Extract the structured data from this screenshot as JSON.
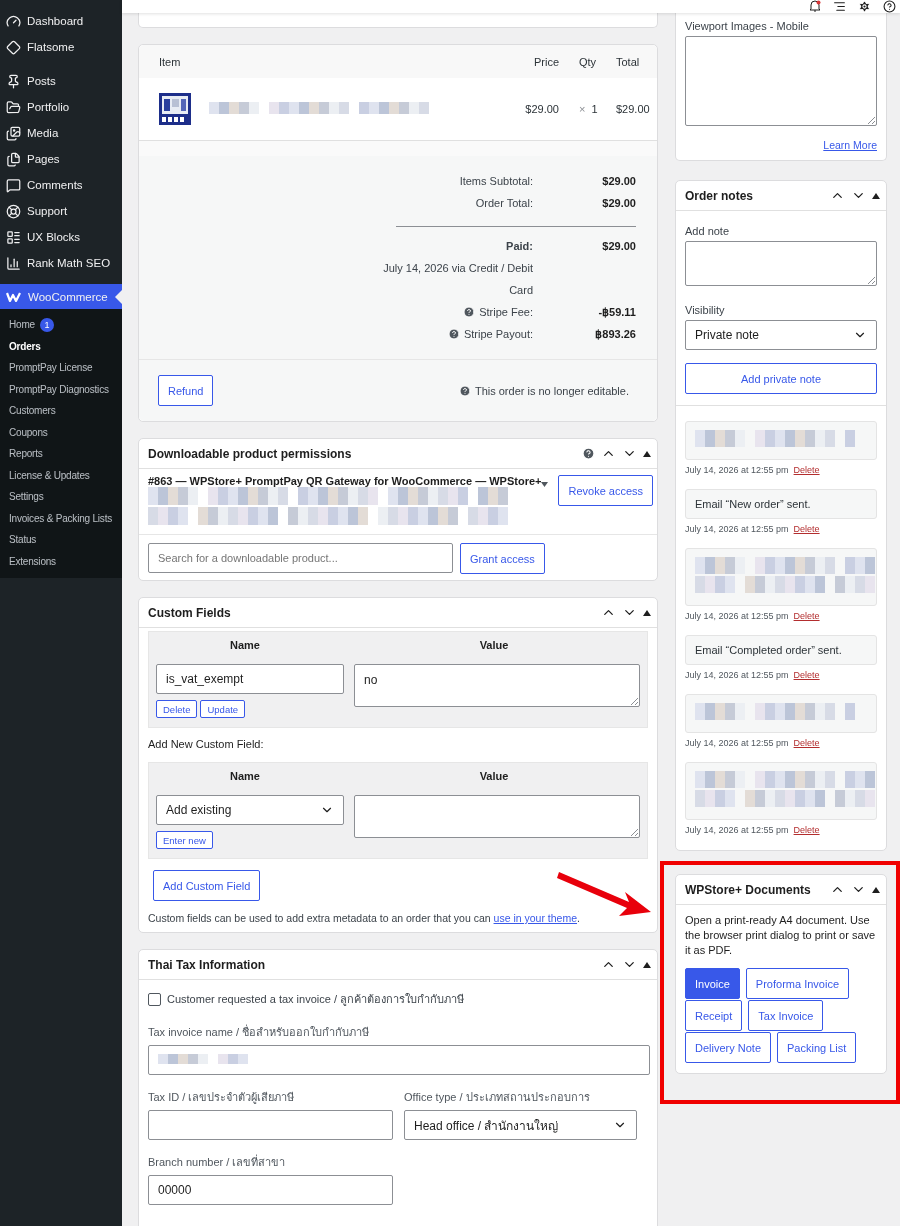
{
  "sidebar": {
    "items": [
      {
        "label": "Dashboard",
        "selected": false
      },
      {
        "label": "Flatsome",
        "selected": false
      },
      {
        "label": "Posts",
        "selected": false
      },
      {
        "label": "Portfolio",
        "selected": false
      },
      {
        "label": "Media",
        "selected": false
      },
      {
        "label": "Pages",
        "selected": false
      },
      {
        "label": "Comments",
        "selected": false
      },
      {
        "label": "Support",
        "selected": false
      },
      {
        "label": "UX Blocks",
        "selected": false
      },
      {
        "label": "Rank Math SEO",
        "selected": false
      },
      {
        "label": "WooCommerce",
        "selected": true
      }
    ],
    "submenu": [
      {
        "label": "Home",
        "badge": "1",
        "selected": false
      },
      {
        "label": "Orders",
        "selected": true
      },
      {
        "label": "PromptPay License",
        "selected": false
      },
      {
        "label": "PromptPay Diagnostics",
        "selected": false
      },
      {
        "label": "Customers",
        "selected": false
      },
      {
        "label": "Coupons",
        "selected": false
      },
      {
        "label": "Reports",
        "selected": false
      },
      {
        "label": "License & Updates",
        "selected": false
      },
      {
        "label": "Settings",
        "selected": false
      },
      {
        "label": "Invoices & Packing Lists",
        "selected": false
      },
      {
        "label": "Status",
        "selected": false
      },
      {
        "label": "Extensions",
        "selected": false
      }
    ]
  },
  "order_items": {
    "columns": [
      "Item",
      "Price",
      "Qty",
      "Total"
    ],
    "rows": [
      {
        "price": "$29.00",
        "qty_mark": "×",
        "qty": "1",
        "total": "$29.00"
      }
    ],
    "totals": [
      {
        "kind": "plain",
        "label": "Items Subtotal:",
        "value": "$29.00"
      },
      {
        "kind": "plain",
        "label": "Order Total:",
        "value": "$29.00"
      },
      {
        "kind": "paid",
        "label": "Paid:",
        "value": "$29.00"
      },
      {
        "kind": "note",
        "label": "July 14, 2026 via Credit / Debit Card"
      },
      {
        "kind": "fee",
        "label": "Stripe Fee:",
        "value": "-฿59.11"
      },
      {
        "kind": "fee",
        "label": "Stripe Payout:",
        "value": "฿893.26"
      }
    ],
    "refund_button": "Refund",
    "locked_note": "This order is no longer editable."
  },
  "downloads": {
    "title": "Downloadable product permissions",
    "product": "#863 — WPStore+ PromptPay QR Gateway for WooCommerce — WPStore+",
    "revoke_button": "Revoke access",
    "search": {
      "placeholder": "Search for a downloadable product..."
    },
    "grant_button": "Grant access"
  },
  "custom_fields": {
    "title": "Custom Fields",
    "columns": [
      "Name",
      "Value"
    ],
    "rows": [
      {
        "name": "is_vat_exempt",
        "value": "no",
        "buttons": [
          "Delete",
          "Update"
        ]
      }
    ],
    "add_label": "Add New Custom Field:",
    "new_columns": [
      "Name",
      "Value"
    ],
    "new_select": "Add existing",
    "enter_new": "Enter new",
    "add_button": "Add Custom Field",
    "note": "Custom fields can be used to add extra metadata to an order that you can",
    "note_link": "use in your theme",
    "note_end": "."
  },
  "thai_tax": {
    "title": "Thai Tax Information",
    "checkbox": {
      "label": "Customer requested a tax invoice / ลูกค้าต้องการใบกำกับภาษี",
      "checked": false
    },
    "name_label": "Tax invoice name / ชื่อสำหรับออกใบกำกับภาษี",
    "tax_id_label": "Tax ID / เลขประจำตัวผู้เสียภาษี",
    "office_label": "Office type / ประเภทสถานประกอบการ",
    "office_value": "Head office / สำนักงานใหญ่",
    "branch_label": "Branch number / เลขที่สาขา",
    "branch_value": "00000"
  },
  "viewport": {
    "label": "Viewport Images - Mobile",
    "link": "Learn More"
  },
  "order_notes": {
    "title": "Order notes",
    "add_label": "Add note",
    "visibility_label": "Visibility",
    "visibility": "Private note",
    "add_button": "Add private note",
    "notes": [
      {
        "kind": "redacted",
        "date": "July 14, 2026 at 12:55 pm",
        "delete": "Delete"
      },
      {
        "kind": "text",
        "text": "Email “New order” sent.",
        "date": "July 14, 2026 at 12:55 pm",
        "delete": "Delete"
      },
      {
        "kind": "redacted_long",
        "date": "July 14, 2026 at 12:55 pm",
        "delete": "Delete"
      },
      {
        "kind": "text",
        "text": "Email “Completed order” sent.",
        "date": "July 14, 2026 at 12:55 pm",
        "delete": "Delete"
      },
      {
        "kind": "redacted",
        "date": "July 14, 2026 at 12:55 pm",
        "delete": "Delete"
      },
      {
        "kind": "redacted_long",
        "date": "July 14, 2026 at 12:55 pm",
        "delete": "Delete"
      }
    ]
  },
  "documents": {
    "title": "WPStore+ Documents",
    "highlighted": true,
    "description": "Open a print-ready A4 document. Use the browser print dialog to print or save it as PDF.",
    "buttons": [
      {
        "label": "Invoice",
        "selected": true
      },
      {
        "label": "Proforma Invoice",
        "selected": false
      },
      {
        "label": "Receipt",
        "selected": false
      },
      {
        "label": "Tax Invoice",
        "selected": false
      },
      {
        "label": "Delivery Note",
        "selected": false
      },
      {
        "label": "Packing List",
        "selected": false
      }
    ]
  },
  "pointer_arrow": true
}
